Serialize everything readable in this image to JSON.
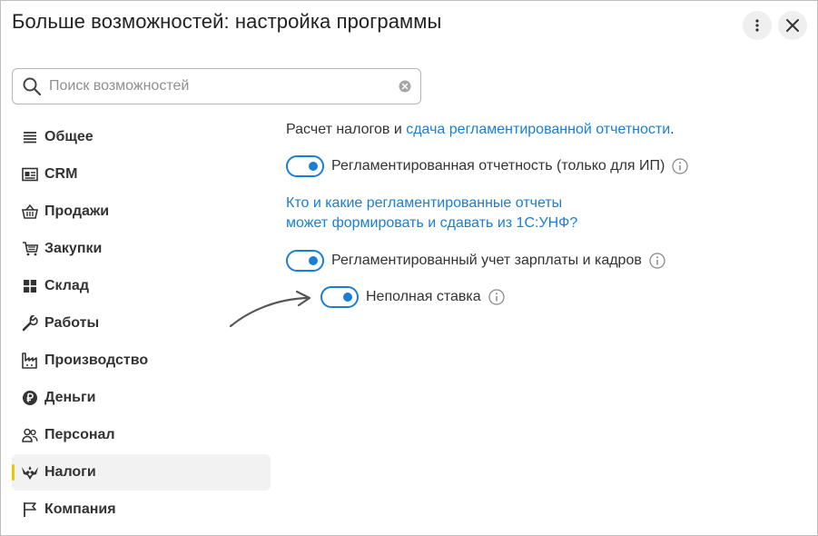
{
  "window": {
    "title": "Больше возможностей: настройка программы"
  },
  "search": {
    "placeholder": "Поиск возможностей",
    "value": ""
  },
  "sidebar": {
    "items": [
      {
        "label": "Общее",
        "icon": "list-icon",
        "active": false
      },
      {
        "label": "CRM",
        "icon": "contact-card-icon",
        "active": false
      },
      {
        "label": "Продажи",
        "icon": "shopping-basket-icon",
        "active": false
      },
      {
        "label": "Закупки",
        "icon": "cart-icon",
        "active": false
      },
      {
        "label": "Склад",
        "icon": "warehouse-grid-icon",
        "active": false
      },
      {
        "label": "Работы",
        "icon": "wrench-icon",
        "active": false
      },
      {
        "label": "Производство",
        "icon": "factory-icon",
        "active": false
      },
      {
        "label": "Деньги",
        "icon": "ruble-coin-icon",
        "active": false
      },
      {
        "label": "Персонал",
        "icon": "people-icon",
        "active": false
      },
      {
        "label": "Налоги",
        "icon": "eagle-emblem-icon",
        "active": true
      },
      {
        "label": "Компания",
        "icon": "flag-icon",
        "active": false
      }
    ]
  },
  "content": {
    "intro_text": "Расчет налогов и ",
    "intro_link": "сдача регламентированной отчетности",
    "intro_end": ".",
    "options": [
      {
        "label": "Регламентированная отчетность (только для ИП)",
        "enabled": true
      },
      {
        "label": "Регламентированный учет зарплаты и кадров",
        "enabled": true
      },
      {
        "label": "Неполная ставка",
        "enabled": true
      }
    ],
    "help_link_line1": "Кто и какие регламентированные отчеты",
    "help_link_line2": "может формировать и сдавать из 1С:УНФ?"
  },
  "colors": {
    "accent": "#1a7ed6",
    "active_marker": "#f5c400",
    "active_bg": "#f2f2f2"
  }
}
